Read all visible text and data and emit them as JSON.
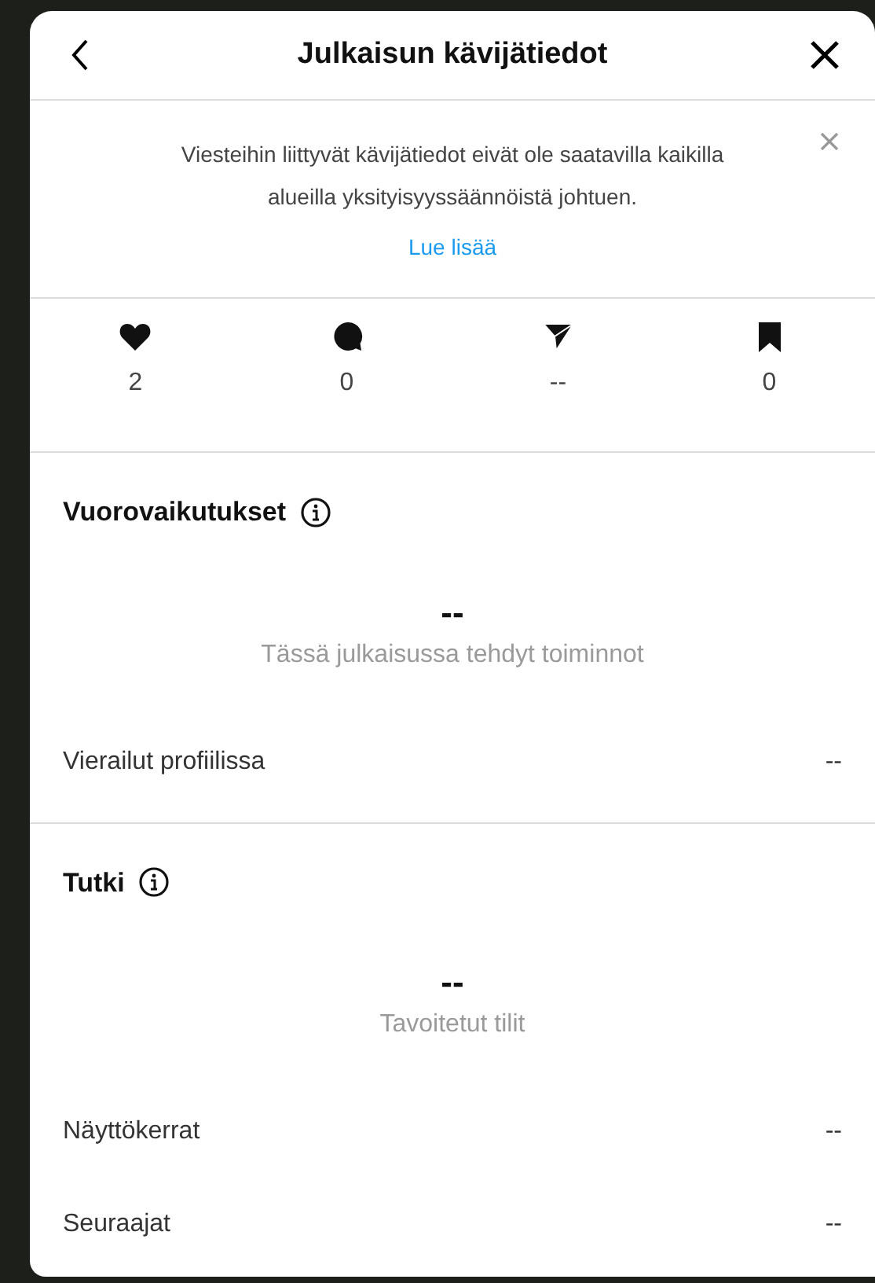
{
  "header": {
    "title": "Julkaisun kävijätiedot"
  },
  "notice": {
    "text": "Viesteihin liittyvät kävijätiedot eivät ole saatavilla kaikilla alueilla yksityisyyssäännöistä johtuen.",
    "link": "Lue lisää"
  },
  "stats": [
    {
      "kind": "like",
      "value": "2"
    },
    {
      "kind": "comment",
      "value": "0"
    },
    {
      "kind": "share",
      "value": "--"
    },
    {
      "kind": "save",
      "value": "0"
    }
  ],
  "sections": [
    {
      "title": "Vuorovaikutukset",
      "total": "--",
      "caption": "Tässä julkaisussa tehdyt toiminnot",
      "rows": [
        {
          "label": "Vierailut profiilissa",
          "value": "--"
        }
      ]
    },
    {
      "title": "Tutki",
      "total": "--",
      "caption": "Tavoitetut tilit",
      "rows": [
        {
          "label": "Näyttökerrat",
          "value": "--"
        },
        {
          "label": "Seuraajat",
          "value": "--"
        }
      ]
    }
  ]
}
